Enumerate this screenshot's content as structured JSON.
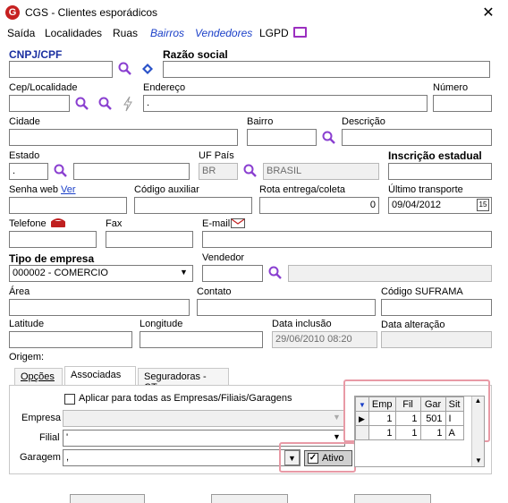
{
  "window": {
    "title": "CGS - Clientes esporádicos",
    "close": "✕"
  },
  "menu": {
    "saida": "Saída",
    "localidades": "Localidades",
    "ruas": "Ruas",
    "bairros": "Bairros",
    "vendedores": "Vendedores",
    "lgpd": "LGPD"
  },
  "form": {
    "cnpj_label": "CNPJ/CPF",
    "razao_label": "Razão social",
    "cep_label": "Cep/Localidade",
    "endereco_label": "Endereço",
    "numero_label": "Número",
    "endereco_value": ".",
    "cidade_label": "Cidade",
    "bairro_label": "Bairro",
    "descricao_label": "Descrição",
    "estado_label": "Estado",
    "estado_value": ".",
    "uf_pais_label": "UF País",
    "uf_pais_value": "BR",
    "pais_value": "BRASIL",
    "inscricao_label": "Inscrição estadual",
    "senha_label": "Senha web",
    "senha_link": "Ver",
    "codigo_aux_label": "Código auxiliar",
    "rota_label": "Rota entrega/coleta",
    "rota_value": "0",
    "ultimo_transporte_label": "Último transporte",
    "ultimo_transporte_value": "09/04/2012",
    "calendar_day": "15",
    "telefone_label": "Telefone",
    "fax_label": "Fax",
    "email_label": "E-mail",
    "tipo_empresa_label": "Tipo de empresa",
    "tipo_empresa_value": "000002 - COMERCIO",
    "vendedor_label": "Vendedor",
    "area_label": "Área",
    "contato_label": "Contato",
    "suframa_label": "Código SUFRAMA",
    "latitude_label": "Latitude",
    "longitude_label": "Longitude",
    "data_inclusao_label": "Data inclusão",
    "data_inclusao_value": "29/06/2010 08:20",
    "data_alteracao_label": "Data alteração",
    "origem_label": "Origem:"
  },
  "tabs": [
    {
      "label": "Opções"
    },
    {
      "label": "Associadas"
    },
    {
      "label": "Seguradoras - CTe"
    }
  ],
  "associadas": {
    "aplicar_label": "Aplicar para todas as Empresas/Filiais/Garagens",
    "empresa_label": "Empresa",
    "filial_label": "Filial",
    "filial_value": "'",
    "garagem_label": "Garagem",
    "garagem_value": ",",
    "ativo_label": "Ativo",
    "grid": {
      "headers": [
        "Emp",
        "Fil",
        "Gar",
        "Sit"
      ],
      "rows": [
        [
          "1",
          "1",
          "501",
          "I"
        ],
        [
          "1",
          "1",
          "1",
          "A"
        ]
      ]
    }
  }
}
